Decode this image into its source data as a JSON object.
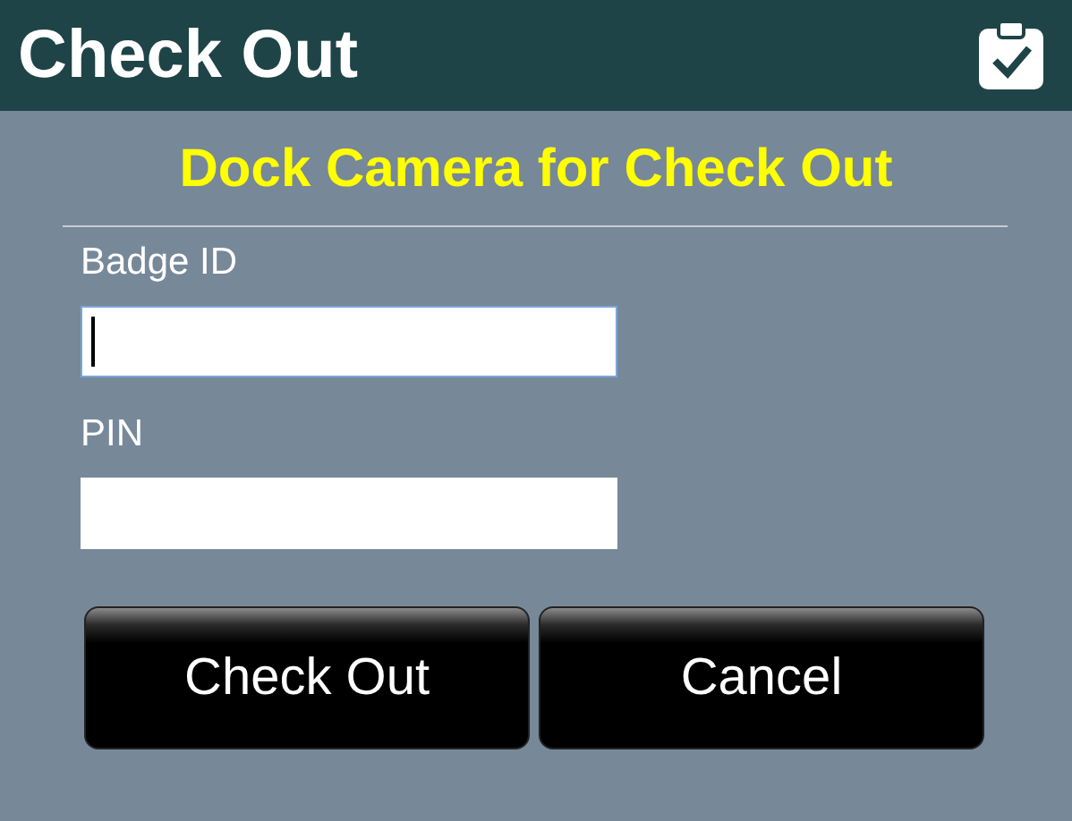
{
  "window": {
    "title": "Check Out"
  },
  "heading": "Dock Camera for Check Out",
  "fields": [
    {
      "label": "Badge ID",
      "focused": true
    },
    {
      "label": "PIN",
      "focused": false
    }
  ],
  "buttons": [
    "Check Out",
    "Cancel"
  ]
}
